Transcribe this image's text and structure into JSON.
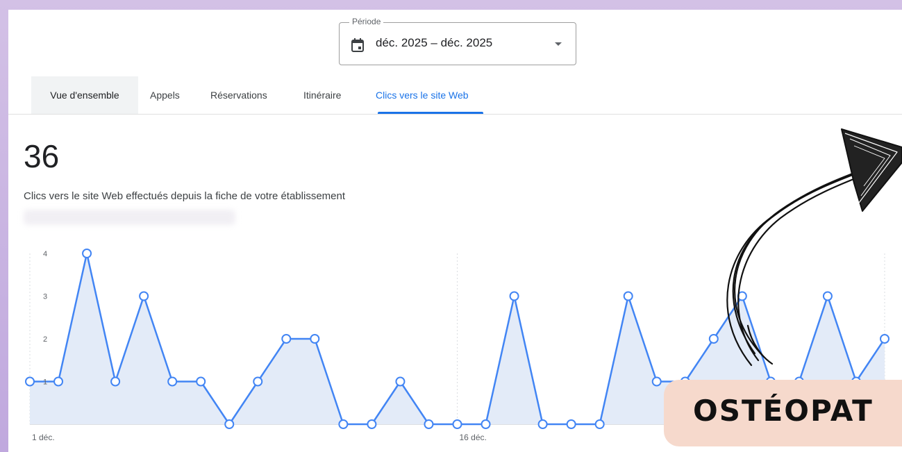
{
  "period": {
    "label": "Période",
    "value": "déc. 2025 – déc. 2025",
    "icon": "calendar-icon",
    "caret_icon": "dropdown-caret-icon"
  },
  "tabs": [
    {
      "label": "Vue d'ensemble",
      "selected_style": "shaded"
    },
    {
      "label": "Appels"
    },
    {
      "label": "Réservations"
    },
    {
      "label": "Itinéraire"
    },
    {
      "label": "Clics vers le site Web",
      "active": true
    }
  ],
  "metric": {
    "value": "36",
    "caption": "Clics vers le site Web effectués depuis la fiche de votre établissement"
  },
  "chart_data": {
    "type": "area",
    "title": "",
    "xlabel": "",
    "ylabel": "",
    "x": [
      "1 déc.",
      "2",
      "3",
      "4",
      "5",
      "6",
      "7",
      "8",
      "9",
      "10",
      "11",
      "12",
      "13",
      "14",
      "15",
      "16 déc.",
      "17",
      "18",
      "19",
      "20",
      "21",
      "22",
      "23",
      "24",
      "25",
      "26",
      "27",
      "28",
      "29",
      "30",
      "31"
    ],
    "x_tick_labels": [
      "1 déc.",
      "16 déc."
    ],
    "y_tick_labels": [
      "1",
      "2",
      "3",
      "4"
    ],
    "series": [
      {
        "values": [
          1,
          1,
          4,
          1,
          3,
          1,
          1,
          0,
          1,
          2,
          2,
          0,
          0,
          1,
          0,
          0,
          0,
          3,
          0,
          0,
          0,
          3,
          1,
          1,
          2,
          3,
          1,
          1,
          3,
          1,
          2
        ]
      }
    ],
    "ylim": [
      0,
      4
    ],
    "grid": "vertical-dotted",
    "line_color": "#4285f4",
    "fill_color": "#e3ebf8"
  },
  "banner": {
    "text": "OSTÉOPAT",
    "color": "#f6d9cc"
  },
  "decoration": {
    "arrow_icon": "hand-drawn-arrow-icon"
  }
}
